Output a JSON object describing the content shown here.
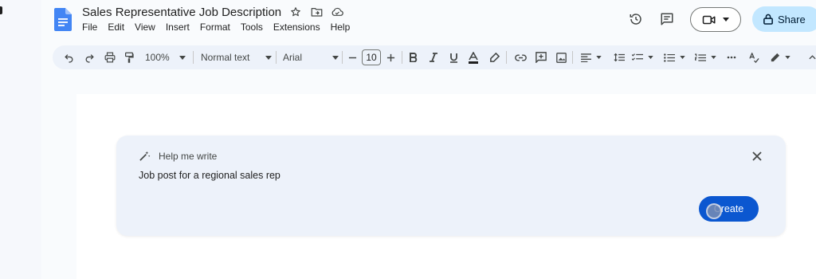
{
  "doc": {
    "title": "Sales Representative Job Description"
  },
  "menu": [
    "File",
    "Edit",
    "View",
    "Insert",
    "Format",
    "Tools",
    "Extensions",
    "Help"
  ],
  "header": {
    "share_label": "Share",
    "history_icon": "history-icon",
    "comments_icon": "comments-icon",
    "meet_icon": "video-camera-icon"
  },
  "toolbar": {
    "zoom": "100%",
    "style": "Normal text",
    "font": "Arial",
    "font_size": "10"
  },
  "help_me_write": {
    "title": "Help me write",
    "prompt": "Job post for a regional sales rep",
    "create_label": "Create"
  },
  "colors": {
    "accent": "#0b57d0",
    "share_bg": "#c2e7ff",
    "toolbar_bg": "#edf2fa",
    "docs_blue": "#4285f4"
  }
}
